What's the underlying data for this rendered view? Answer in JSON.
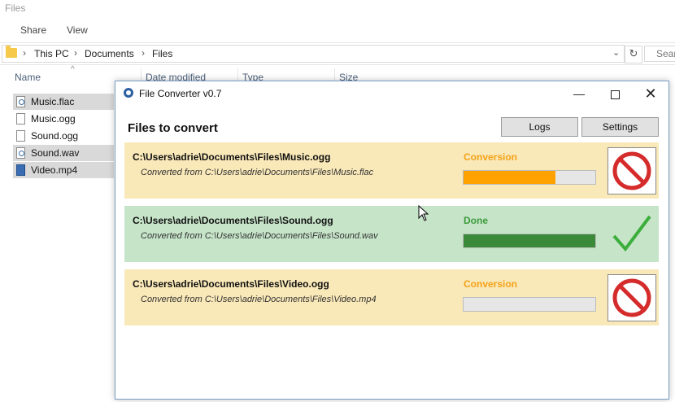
{
  "explorer": {
    "title": "Files",
    "ribbon": {
      "share": "Share",
      "view": "View"
    },
    "breadcrumb": [
      "This PC",
      "Documents",
      "Files"
    ],
    "search_placeholder": "Sear",
    "columns": {
      "name": "Name",
      "date_modified": "Date modified",
      "type": "Type",
      "size": "Size"
    },
    "files": [
      {
        "name": "Music.flac",
        "icon": "audio-file-icon",
        "selected": true
      },
      {
        "name": "Music.ogg",
        "icon": "file-icon",
        "selected": false
      },
      {
        "name": "Sound.ogg",
        "icon": "file-icon",
        "selected": false
      },
      {
        "name": "Sound.wav",
        "icon": "audio-file-icon",
        "selected": true
      },
      {
        "name": "Video.mp4",
        "icon": "video-file-icon",
        "selected": true
      }
    ]
  },
  "converter": {
    "title": "File Converter v0.7",
    "heading": "Files to convert",
    "buttons": {
      "logs": "Logs",
      "settings": "Settings"
    },
    "colors": {
      "conversion_bg": "#f9e8b8",
      "done_bg": "#c6e4c8",
      "conversion_text": "#f5a218",
      "done_text": "#3b9a3b",
      "progress_conversion": "#ffa200",
      "progress_done": "#3a8a3a",
      "cancel_red": "#d52b2b"
    },
    "jobs": [
      {
        "path": "C:\\Users\\adrie\\Documents\\Files\\Music.ogg",
        "source": "Converted from C:\\Users\\adrie\\Documents\\Files\\Music.flac",
        "status": "Conversion",
        "progress": 0.7,
        "action_icon": "cancel-icon"
      },
      {
        "path": "C:\\Users\\adrie\\Documents\\Files\\Sound.ogg",
        "source": "Converted from C:\\Users\\adrie\\Documents\\Files\\Sound.wav",
        "status": "Done",
        "progress": 1.0,
        "action_icon": "checkmark-icon"
      },
      {
        "path": "C:\\Users\\adrie\\Documents\\Files\\Video.ogg",
        "source": "Converted from C:\\Users\\adrie\\Documents\\Files\\Video.mp4",
        "status": "Conversion",
        "progress": 0.0,
        "action_icon": "cancel-icon"
      }
    ]
  }
}
